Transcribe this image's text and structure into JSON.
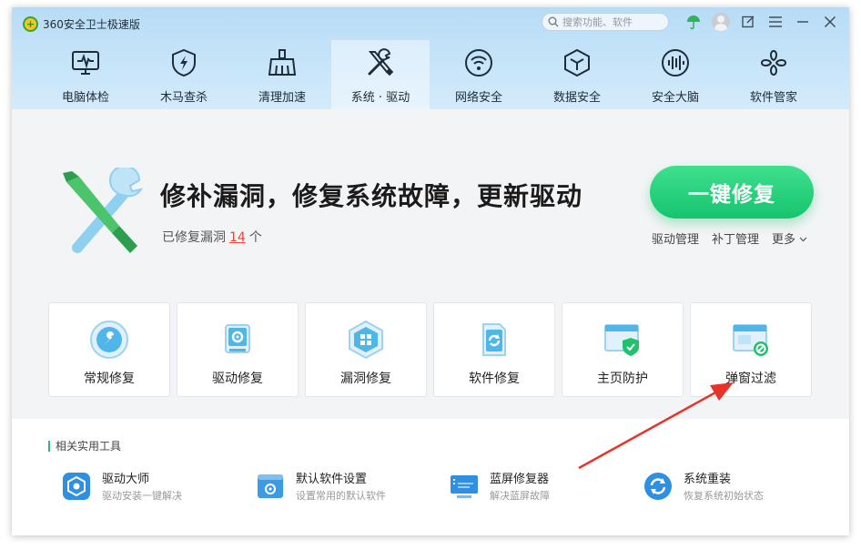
{
  "app": {
    "title": "360安全卫士极速版",
    "logo_glyph": "+"
  },
  "search": {
    "placeholder": "搜索功能、软件"
  },
  "nav": {
    "tabs": [
      {
        "label": "电脑体检",
        "icon": "monitor-pulse-icon"
      },
      {
        "label": "木马查杀",
        "icon": "shield-bolt-icon"
      },
      {
        "label": "清理加速",
        "icon": "broom-icon"
      },
      {
        "label": "系统 · 驱动",
        "icon": "wrench-screwdriver-icon",
        "active": true
      },
      {
        "label": "网络安全",
        "icon": "wifi-icon"
      },
      {
        "label": "数据安全",
        "icon": "cube-icon"
      },
      {
        "label": "安全大脑",
        "icon": "brain-wave-icon"
      },
      {
        "label": "软件管家",
        "icon": "apps-icon"
      }
    ]
  },
  "hero": {
    "title": "修补漏洞，修复系统故障，更新驱动",
    "subtitle_prefix": "已修复漏洞",
    "repaired_count": "14",
    "subtitle_suffix": "个",
    "fix_button": "一键修复",
    "links": {
      "driver": "驱动管理",
      "patch": "补丁管理",
      "more": "更多"
    }
  },
  "cards": [
    {
      "label": "常规修复",
      "icon": "wrench-circle-icon"
    },
    {
      "label": "驱动修复",
      "icon": "gear-chip-icon"
    },
    {
      "label": "漏洞修复",
      "icon": "windows-shield-icon"
    },
    {
      "label": "软件修复",
      "icon": "refresh-file-icon"
    },
    {
      "label": "主页防护",
      "icon": "browser-shield-icon"
    },
    {
      "label": "弹窗过滤",
      "icon": "popup-block-icon"
    }
  ],
  "tools": {
    "heading": "相关实用工具",
    "items": [
      {
        "name": "驱动大师",
        "desc": "驱动安装一键解决",
        "icon": "driver-master-icon"
      },
      {
        "name": "默认软件设置",
        "desc": "设置常用的默认软件",
        "icon": "default-software-icon"
      },
      {
        "name": "蓝屏修复器",
        "desc": "解决蓝屏故障",
        "icon": "bluescreen-icon"
      },
      {
        "name": "系统重装",
        "desc": "恢复系统初始状态",
        "icon": "system-reinstall-icon"
      }
    ]
  },
  "colors": {
    "accent_green": "#1fc86f",
    "header_blue": "#c4e3f8",
    "highlight_red": "#e8453c"
  }
}
